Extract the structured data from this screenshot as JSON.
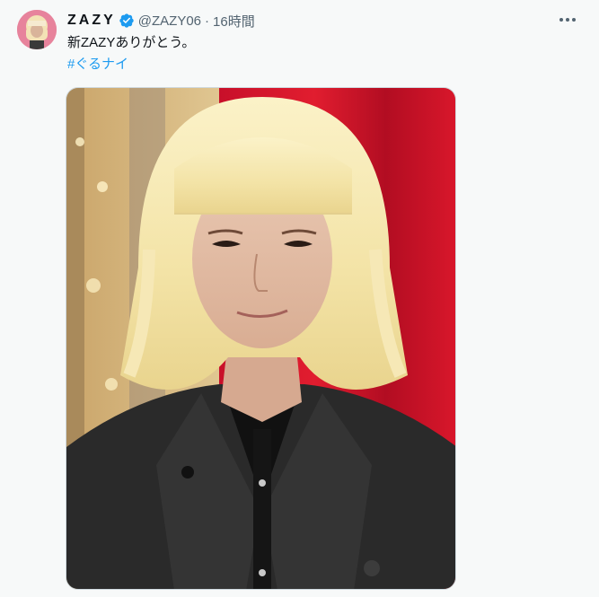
{
  "tweet": {
    "display_name": "ZAZY",
    "handle": "@ZAZY06",
    "separator": "·",
    "time": "16時間",
    "text": "新ZAZYありがとう。",
    "hashtag": "#ぐるナイ"
  },
  "icons": {
    "verified": "verified-badge-icon",
    "more": "more-options-icon"
  },
  "colors": {
    "background": "#f7f9f9",
    "text": "#0f1419",
    "secondary_text": "#536471",
    "link": "#1d9bf0",
    "verified": "#1d9bf0"
  }
}
